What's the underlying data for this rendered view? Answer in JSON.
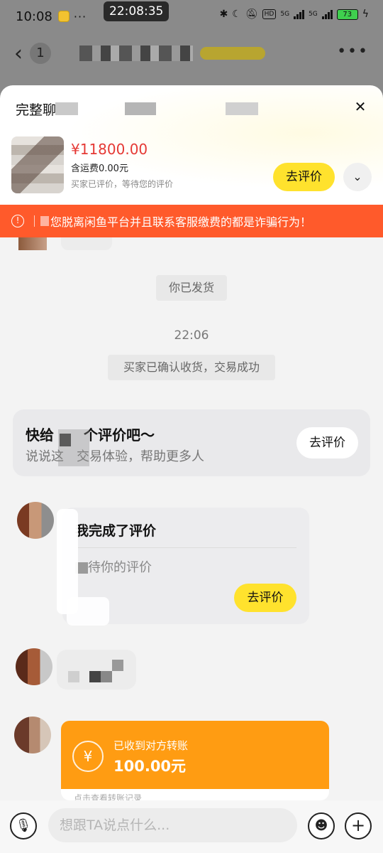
{
  "status_bar": {
    "time": "10:08",
    "clock_overlay": "22:08:35",
    "more": "···",
    "network_5g_a": "5G",
    "network_5g_b": "5G",
    "hd": "HD",
    "battery": "73"
  },
  "header": {
    "unread_count": "1"
  },
  "sheet": {
    "title": "完整聊",
    "price": "¥11800.00",
    "shipping": "含运费0.00元",
    "status_note": "买家已评价，等待您的评价",
    "review_button": "去评价"
  },
  "warning": {
    "text": "您脱离闲鱼平台并且联系客服缴费的都是诈骗行为！"
  },
  "chat": {
    "shipped_notice": "你已发货",
    "timestamp": "22:06",
    "confirm_notice": "买家已确认收货，交易成功",
    "review_card": {
      "title": "快给",
      "title_suffix": "个评价吧～",
      "sub_prefix": "说说这",
      "sub_suffix": "交易体验，帮助更多人",
      "button": "去评价"
    },
    "notice_card": {
      "title": "我完成了评价",
      "text": "待你的评价",
      "button": "去评价"
    },
    "transfer": {
      "label": "已收到对方转账",
      "amount": "100.00元",
      "footer": "点击查看转账记录",
      "icon_glyph": "¥"
    }
  },
  "input": {
    "placeholder": "想跟TA说点什么..."
  }
}
